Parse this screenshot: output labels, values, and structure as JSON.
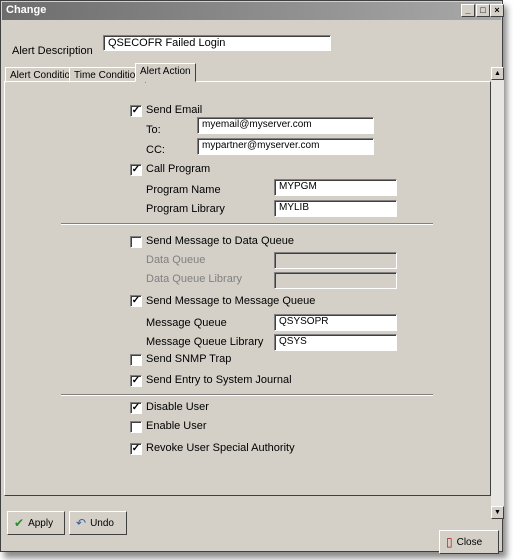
{
  "window": {
    "title": "Change",
    "minimize": "_",
    "maximize": "□",
    "close": "×"
  },
  "alert_description": {
    "label": "Alert Description",
    "value": "QSECOFR Failed Login"
  },
  "tabs": [
    {
      "label": "Alert Condition"
    },
    {
      "label": "Time Condition"
    },
    {
      "label": "Alert Action",
      "selected": true
    }
  ],
  "action": {
    "send_email": {
      "label": "Send Email",
      "checked": true
    },
    "to": {
      "label": "To:",
      "value": "myemail@myserver.com"
    },
    "cc": {
      "label": "CC:",
      "value": "mypartner@myserver.com"
    },
    "call_program": {
      "label": "Call Program",
      "checked": true
    },
    "program_name": {
      "label": "Program Name",
      "value": "MYPGM"
    },
    "program_library": {
      "label": "Program Library",
      "value": "MYLIB"
    },
    "send_data_queue": {
      "label": "Send Message to Data Queue",
      "checked": false
    },
    "data_queue": {
      "label": "Data Queue",
      "value": ""
    },
    "data_queue_library": {
      "label": "Data Queue Library",
      "value": ""
    },
    "send_message_queue": {
      "label": "Send Message to Message Queue",
      "checked": true
    },
    "message_queue": {
      "label": "Message Queue",
      "value": "QSYSOPR"
    },
    "message_queue_library": {
      "label": "Message Queue Library",
      "value": "QSYS"
    },
    "send_snmp": {
      "label": "Send SNMP Trap",
      "checked": false
    },
    "send_journal": {
      "label": "Send Entry to System Journal",
      "checked": true
    },
    "disable_user": {
      "label": "Disable User",
      "checked": true
    },
    "enable_user": {
      "label": "Enable User",
      "checked": false
    },
    "revoke_authority": {
      "label": "Revoke User Special Authority",
      "checked": true
    }
  },
  "buttons": {
    "apply": "Apply",
    "undo": "Undo",
    "close": "Close"
  },
  "check_mark": "✓"
}
